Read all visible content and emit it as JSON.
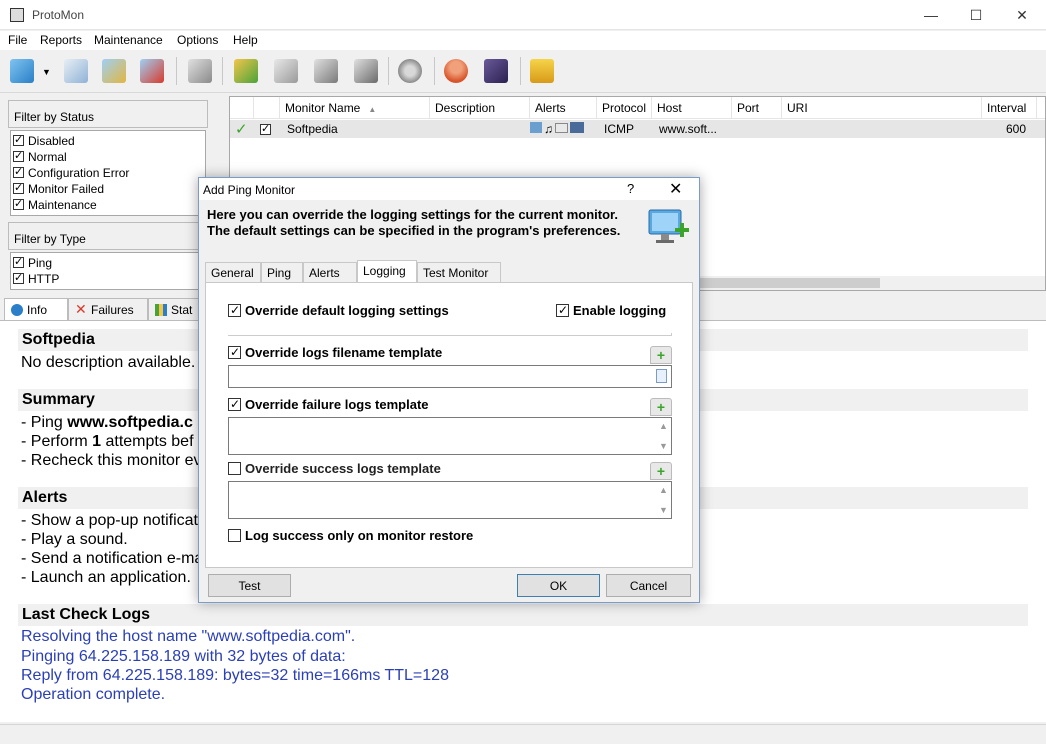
{
  "window": {
    "title": "ProtoMon"
  },
  "menu": [
    "File",
    "Reports",
    "Maintenance",
    "Options",
    "Help"
  ],
  "filters": {
    "status_heading": "Filter by Status",
    "status_items": [
      "Disabled",
      "Normal",
      "Configuration Error",
      "Monitor Failed",
      "Maintenance"
    ],
    "type_heading": "Filter by Type",
    "type_items": [
      "Ping",
      "HTTP"
    ]
  },
  "grid": {
    "columns": [
      "Monitor Name",
      "Description",
      "Alerts",
      "Protocol",
      "Host",
      "Port",
      "URI",
      "Interval"
    ],
    "rows": [
      {
        "name": "Softpedia",
        "description": "",
        "protocol": "ICMP",
        "host": "www.soft...",
        "port": "",
        "uri": "",
        "interval": "600"
      }
    ]
  },
  "detail_tabs": [
    "Info",
    "Failures",
    "Stat"
  ],
  "details": {
    "name": "Softpedia",
    "description": "No description available.",
    "summary_heading": "Summary",
    "summary_lines": [
      "- Ping ",
      "www.softpedia.c",
      "- Perform ",
      "1",
      " attempts bef",
      "- Recheck this monitor ev"
    ],
    "alerts_heading": "Alerts",
    "alerts_lines": [
      "- Show a pop-up notificat",
      "- Play a sound.",
      "- Send a notification e-ma",
      "- Launch an application."
    ],
    "logs_heading": "Last Check Logs",
    "logs_lines": [
      "Resolving the host name \"www.softpedia.com\".",
      "Pinging 64.225.158.189 with 32 bytes of data:",
      "Reply from 64.225.158.189: bytes=32 time=166ms TTL=128",
      "Operation complete."
    ]
  },
  "dialog": {
    "title": "Add Ping Monitor",
    "help": "?",
    "close": "✕",
    "description": "Here you can override the logging settings for the current monitor. The default settings can be specified in the program's preferences.",
    "tabs": [
      "General",
      "Ping",
      "Alerts",
      "Logging",
      "Test Monitor"
    ],
    "active_tab": "Logging",
    "override_default": "Override default logging settings",
    "enable_logging": "Enable logging",
    "override_filename": "Override logs filename template",
    "override_failure": "Override failure logs template",
    "override_success": "Override success logs template",
    "log_success_only": "Log success only on monitor restore",
    "test_button": "Test",
    "ok_button": "OK",
    "cancel_button": "Cancel"
  },
  "colors": {
    "log_text": "#2b3fb6",
    "dialog_border": "#7a9cc9",
    "check_green": "#3aa52a"
  }
}
